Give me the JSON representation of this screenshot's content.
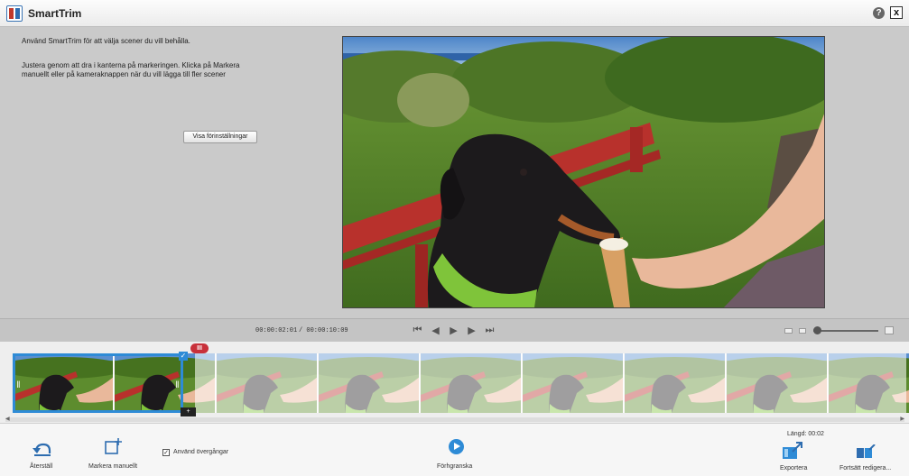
{
  "window": {
    "title": "SmartTrim",
    "help_label": "?",
    "close_label": "x"
  },
  "instructions": {
    "line1": "Använd SmartTrim för att välja scener du vill behålla.",
    "line2": "Justera genom att dra i kanterna på markeringen. Klicka på Markera manuellt eller på kameraknappen när du vill lägga till fler scener",
    "presets_button": "Visa förinställningar"
  },
  "player": {
    "current_time": "00:00:02:01",
    "total_time": "/ 00:00:10:09",
    "transport": [
      "⏮",
      "◀",
      "▶",
      "▶",
      "⏭"
    ],
    "zoom_level": 0.05
  },
  "timeline": {
    "thumbnail_count": 9,
    "selection_marker": "III",
    "check_mark": "✓",
    "camera_badge": "+",
    "scroll_left": "◀",
    "scroll_right": "▶"
  },
  "bottom": {
    "undo_label": "Återställ",
    "mark_manual_label": "Markera manuellt",
    "transitions_label": "Använd övergångar",
    "transitions_checked": "✓",
    "preview_label": "Förhgranska",
    "length_label": "Längd: 00:02",
    "export_label": "Exportera",
    "continue_label": "Fortsätt redigera..."
  },
  "colors": {
    "accent": "#2e8bd6",
    "marker": "#c8303a"
  }
}
